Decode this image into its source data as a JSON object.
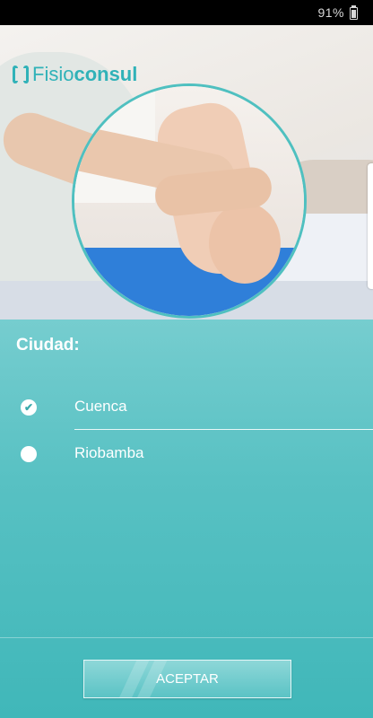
{
  "status_bar": {
    "battery": "91%"
  },
  "brand": {
    "logo_part1": "Fisio",
    "logo_part2": "consul"
  },
  "form": {
    "city_label": "Ciudad:",
    "options": [
      {
        "label": "Cuenca",
        "selected": true
      },
      {
        "label": "Riobamba",
        "selected": false
      }
    ],
    "submit_label": "ACEPTAR"
  },
  "colors": {
    "accent": "#40b7b9",
    "logo": "#30b2b8",
    "panel_top": "#76cdcf"
  },
  "icons": {
    "selected_option": "check-icon",
    "unselected_option": "radio-empty-icon"
  }
}
